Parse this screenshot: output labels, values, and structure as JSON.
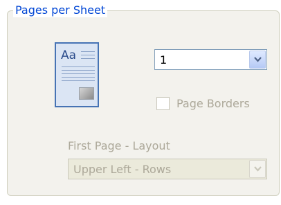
{
  "group": {
    "title": "Pages per Sheet"
  },
  "preview": {
    "sample_text": "Aa",
    "icon": "page-layout-preview-icon"
  },
  "pages_per_sheet": {
    "value": "1",
    "dropdown_icon": "chevron-down-icon"
  },
  "page_borders": {
    "label": "Page Borders",
    "checked": false,
    "enabled": false
  },
  "first_page_layout": {
    "label": "First Page - Layout",
    "value": "Upper Left - Rows",
    "enabled": false,
    "dropdown_icon": "chevron-down-icon"
  },
  "colors": {
    "accent": "#0046d5",
    "disabled_text": "#aca899"
  }
}
